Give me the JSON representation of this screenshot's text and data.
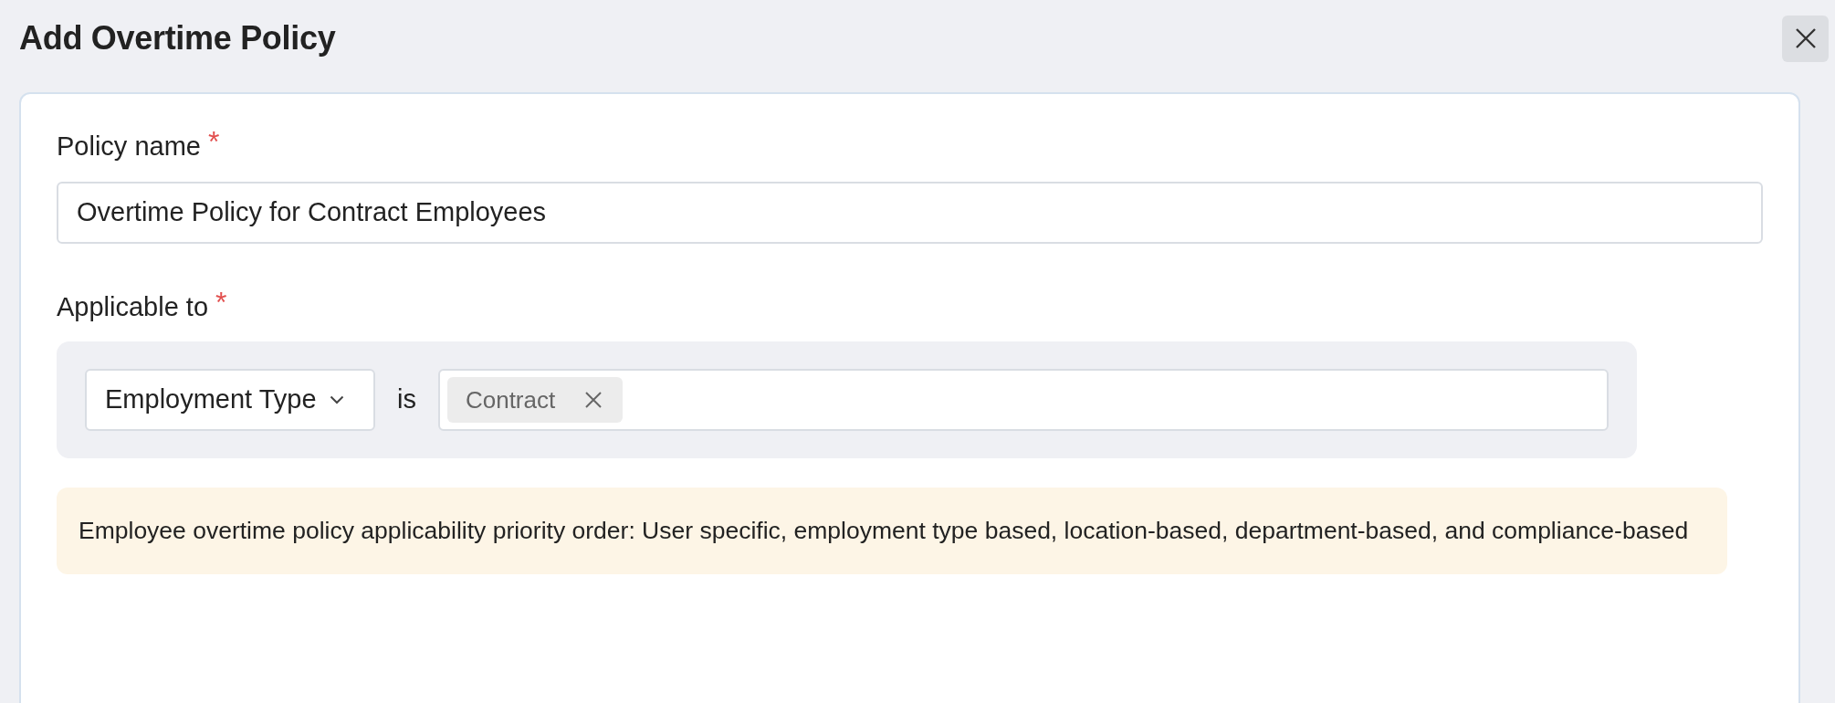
{
  "title": "Add Overtime Policy",
  "fields": [
    {
      "kind": "text",
      "label": "Policy name",
      "required_mark": "*",
      "value": "Overtime Policy for Contract Employees"
    },
    {
      "kind": "condition",
      "label": "Applicable to",
      "required_mark": "*",
      "condition": {
        "field": "Employment Type",
        "operator": "is",
        "values": [
          "Contract"
        ]
      }
    }
  ],
  "note": "Employee overtime policy applicability priority order: User specific, employment type based, location-based, department-based, and compliance-based"
}
